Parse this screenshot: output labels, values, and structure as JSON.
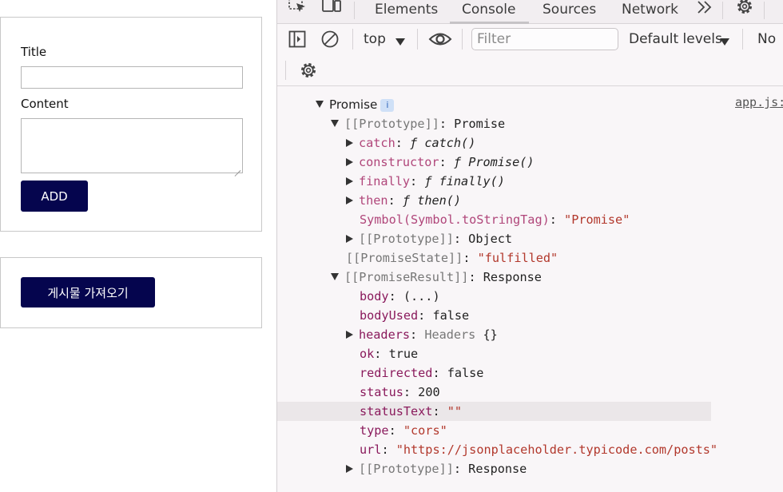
{
  "page": {
    "form": {
      "title_label": "Title",
      "content_label": "Content",
      "title_value": "",
      "content_value": "",
      "add_button": "ADD"
    },
    "fetch_button": "게시물 가져오기"
  },
  "devtools": {
    "tabs": [
      "Elements",
      "Console",
      "Sources",
      "Network"
    ],
    "active_tab": "Console",
    "more_tabs_icon": "chevron-double-right-icon",
    "toolbar": {
      "context": "top",
      "filter_placeholder": "Filter",
      "levels": "Default levels",
      "issues": "No"
    },
    "source_link": "app.js:",
    "info_badge": "i",
    "promise": {
      "label": "Promise",
      "proto_key": "[[Prototype]]",
      "proto_val": "Promise",
      "methods": [
        {
          "name": "catch",
          "fn": "catch()"
        },
        {
          "name": "constructor",
          "fn": "Promise()"
        },
        {
          "name": "finally",
          "fn": "finally()"
        },
        {
          "name": "then",
          "fn": "then()"
        }
      ],
      "symbol_key": "Symbol(Symbol.toStringTag)",
      "symbol_val": "\"Promise\"",
      "inner_proto_key": "[[Prototype]]",
      "inner_proto_val": "Object",
      "state_key": "[[PromiseState]]",
      "state_val": "\"fulfilled\"",
      "result_key": "[[PromiseResult]]",
      "result_val": "Response"
    },
    "response": {
      "body_key": "body",
      "body_val": "(...)",
      "bodyUsed_key": "bodyUsed",
      "bodyUsed_val": "false",
      "headers_key": "headers",
      "headers_type": "Headers",
      "headers_val": "{}",
      "ok_key": "ok",
      "ok_val": "true",
      "redirected_key": "redirected",
      "redirected_val": "false",
      "status_key": "status",
      "status_val": "200",
      "statusText_key": "statusText",
      "statusText_val": "\"\"",
      "type_key": "type",
      "type_val": "\"cors\"",
      "url_key": "url",
      "url_val": "\"https://jsonplaceholder.typicode.com/posts\"",
      "proto_key": "[[Prototype]]",
      "proto_val": "Response"
    },
    "fn_symbol": "ƒ",
    "colon": ": "
  }
}
